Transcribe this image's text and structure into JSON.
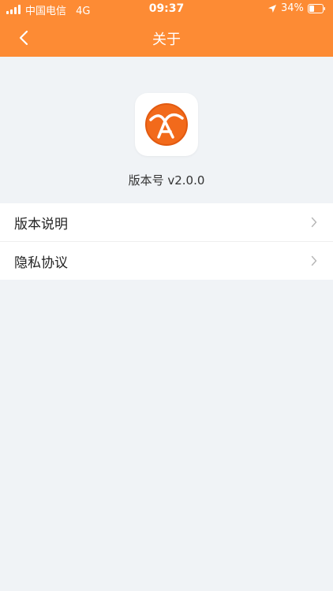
{
  "status_bar": {
    "carrier": "中国电信",
    "network": "4G",
    "time": "09:37",
    "battery": "34%"
  },
  "nav": {
    "title": "关于",
    "back_icon": "chevron-left-icon"
  },
  "app": {
    "version": "版本号 v2.0.0",
    "logo_icon": "app-logo-icon"
  },
  "menu": {
    "items": [
      {
        "label": "版本说明",
        "icon": "chevron-right-icon"
      },
      {
        "label": "隐私协议",
        "icon": "chevron-right-icon"
      }
    ]
  },
  "colors": {
    "accent": "#fd8b34",
    "background": "#f0f3f6",
    "logo_orange": "#f26a1b"
  }
}
